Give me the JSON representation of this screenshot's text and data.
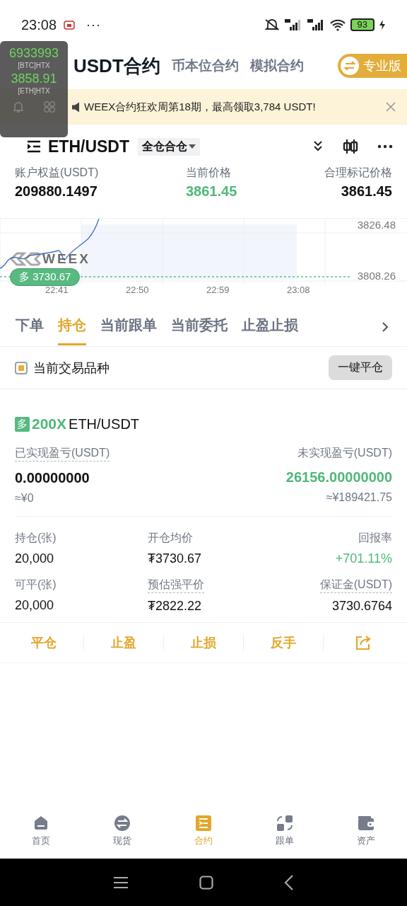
{
  "status_bar": {
    "time": "23:08",
    "more": "···",
    "battery": "93"
  },
  "floating_ticker": {
    "items": [
      {
        "price": "6933993",
        "label": "[BTC]HTX"
      },
      {
        "price": "3858.91",
        "label": "[ETH]HTX"
      }
    ]
  },
  "header": {
    "tabs": [
      {
        "label": "USDT合约",
        "selected": true
      },
      {
        "label": "币本位合约",
        "selected": false
      },
      {
        "label": "模拟合约",
        "selected": false
      }
    ],
    "pro_button": "专业版"
  },
  "banner": {
    "text": "WEEX合约狂欢周第18期，最高领取3,784 USDT!"
  },
  "pair": {
    "symbol": "ETH/USDT",
    "margin_mode": "全仓合仓"
  },
  "stats": [
    {
      "label": "账户权益(USDT)",
      "value": "209880.1497",
      "kind": "plain"
    },
    {
      "label": "当前价格",
      "value": "3861.45",
      "kind": "up"
    },
    {
      "label": "合理标记价格",
      "value": "3861.45",
      "kind": "plain"
    }
  ],
  "chart": {
    "y_labels": [
      "3826.48",
      "3808.26"
    ],
    "x_labels": [
      "22:41",
      "22:50",
      "22:59",
      "23:08"
    ],
    "position_tag": "多 3730.67",
    "watermark": "WEEX"
  },
  "position_tabs": [
    {
      "label": "下单",
      "selected": false
    },
    {
      "label": "持仓",
      "selected": true
    },
    {
      "label": "当前跟单",
      "selected": false
    },
    {
      "label": "当前委托",
      "selected": false
    },
    {
      "label": "止盈止损",
      "selected": false
    }
  ],
  "filter": {
    "label": "当前交易品种",
    "checked": true,
    "close_all": "一键平仓"
  },
  "position": {
    "side": "多",
    "leverage": "200X",
    "symbol": "ETH/USDT",
    "pnl": [
      {
        "label": "已实现盈亏(USDT)",
        "underlined": true,
        "value": "0.00000000",
        "kind": "plain",
        "cny": "≈¥0"
      },
      {
        "label": "未实现盈亏(USDT)",
        "underlined": false,
        "value": "26156.00000000",
        "kind": "up",
        "cny": "≈¥189421.75"
      }
    ],
    "fields": [
      {
        "label": "持仓(张)",
        "underlined": false,
        "value": "20,000",
        "kind": "plain"
      },
      {
        "label": "开仓均价",
        "underlined": false,
        "value": "₮3730.67",
        "kind": "plain"
      },
      {
        "label": "回报率",
        "underlined": false,
        "value": "+701.11%",
        "kind": "up"
      },
      {
        "label": "可平(张)",
        "underlined": false,
        "value": "20,000",
        "kind": "plain"
      },
      {
        "label": "预估强平价",
        "underlined": true,
        "value": "₮2822.22",
        "kind": "plain"
      },
      {
        "label": "保证金(USDT)",
        "underlined": true,
        "value": "3730.6764",
        "kind": "plain"
      }
    ],
    "actions": [
      "平仓",
      "止盈",
      "止损",
      "反手"
    ]
  },
  "bottom_nav": [
    {
      "label": "首页",
      "kind": "home",
      "selected": false
    },
    {
      "label": "现货",
      "kind": "spot",
      "selected": false
    },
    {
      "label": "合约",
      "kind": "futures",
      "selected": true
    },
    {
      "label": "跟单",
      "kind": "copy",
      "selected": false
    },
    {
      "label": "资产",
      "kind": "wallet",
      "selected": false
    }
  ]
}
